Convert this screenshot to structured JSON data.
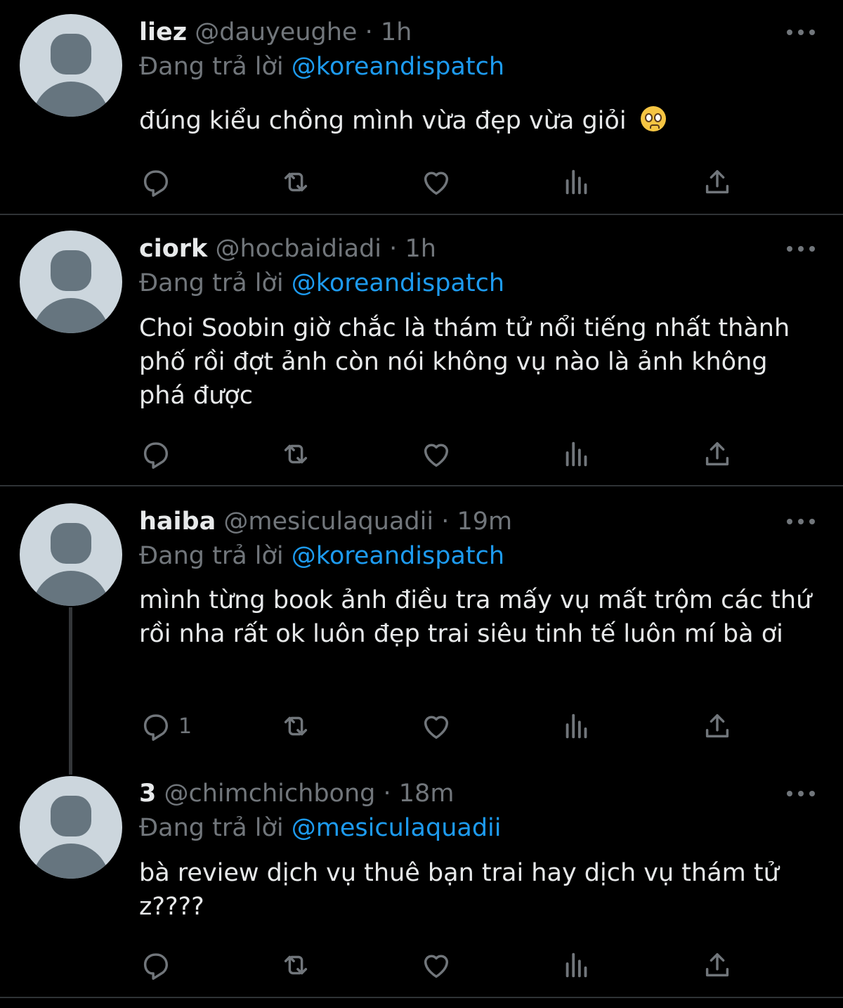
{
  "colors": {
    "background": "#000000",
    "text": "#e7e9ea",
    "muted": "#71767b",
    "link": "#1d9bf0",
    "divider": "#2f3336"
  },
  "icons": [
    "more-icon",
    "reply-icon",
    "retweet-icon",
    "like-icon",
    "views-icon",
    "share-icon",
    "pleading-face-emoji"
  ],
  "tweets": [
    {
      "name": "liez",
      "handle": "@dauyeughe",
      "dot": "·",
      "time": "1h",
      "reply_prefix": "Đang trả lời",
      "reply_to": "@koreandispatch",
      "text": "đúng kiểu chồng mình vừa đẹp vừa giỏi",
      "reply_count": ""
    },
    {
      "name": "ciork",
      "handle": "@hocbaidiadi",
      "dot": "·",
      "time": "1h",
      "reply_prefix": "Đang trả lời",
      "reply_to": "@koreandispatch",
      "text": "Choi Soobin giờ chắc là thám tử nổi tiếng nhất thành phố rồi đợt ảnh còn nói không vụ nào là ảnh không phá được",
      "reply_count": ""
    },
    {
      "name": "haiba",
      "handle": "@mesiculaquadii",
      "dot": "·",
      "time": "19m",
      "reply_prefix": "Đang trả lời",
      "reply_to": "@koreandispatch",
      "text": "mình từng book ảnh điều tra mấy vụ mất trộm các thứ rồi nha rất ok luôn đẹp trai siêu tinh tế luôn mí bà ơi",
      "reply_count": "1"
    },
    {
      "name": "3",
      "handle": "@chimchichbong",
      "dot": "·",
      "time": "18m",
      "reply_prefix": "Đang trả lời",
      "reply_to": "@mesiculaquadii",
      "text": "bà review dịch vụ thuê bạn trai hay dịch vụ thám tử z????",
      "reply_count": ""
    }
  ]
}
